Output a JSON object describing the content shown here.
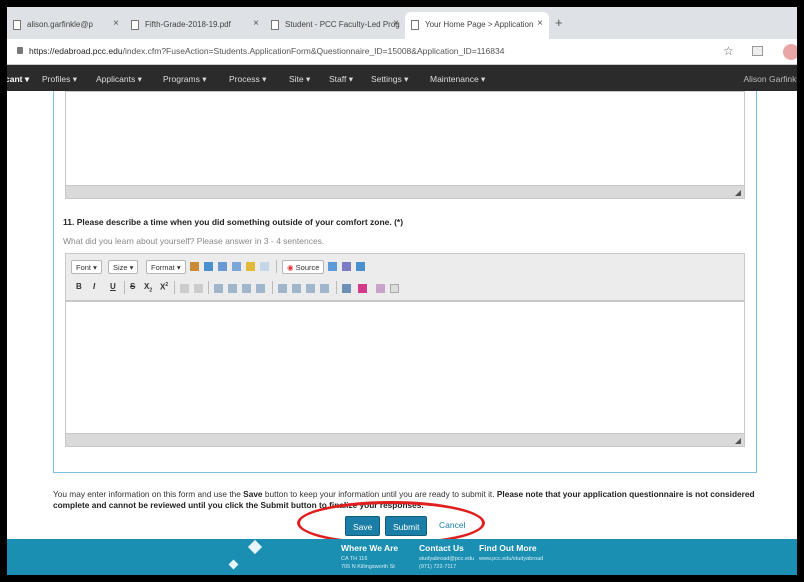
{
  "browser": {
    "tabs": [
      {
        "label": "alison.garfinkle@p",
        "active": false
      },
      {
        "label": "Fifth-Grade-2018-19.pdf",
        "active": false
      },
      {
        "label": "Student - PCC Faculty-Led Prog",
        "active": false
      },
      {
        "label": "Your Home Page > Application",
        "active": true
      }
    ],
    "new_tab": "+",
    "url_domain": "https://edabroad.pcc.edu",
    "url_path": "/index.cfm?FuseAction=Students.ApplicationForm&Questionnaire_ID=15008&Application_ID=116834",
    "star": "☆"
  },
  "nav": {
    "first": "cant",
    "items": [
      "Profiles",
      "Applicants",
      "Programs",
      "Process",
      "Site",
      "Staff",
      "Settings",
      "Maintenance"
    ],
    "user": "Alison Garfinkle"
  },
  "question": {
    "title": "11. Please describe a time when you did something outside of your comfort zone.  (*)",
    "hint": "What did you learn about yourself? Please answer in 3 - 4 sentences."
  },
  "editor": {
    "font": "Font",
    "size": "Size",
    "format": "Format",
    "source": "Source",
    "bold": "B",
    "italic": "I",
    "underline": "U"
  },
  "notice": {
    "p1": "You may enter information on this form and use the ",
    "save_word": "Save",
    "p2": " button to keep your information until you are ready to submit it. ",
    "bold1": "Please note that your application questionnaire is not considered complete and cannot be reviewed until you click the Submit button to finalize your responses."
  },
  "actions": {
    "save": "Save",
    "submit": "Submit",
    "cancel": "Cancel"
  },
  "footer": {
    "col1_title": "Where We Are",
    "col1_line1": "CA TH 116",
    "col1_line2": "705 N Killingsworth St",
    "col2_title": "Contact Us",
    "col2_line1": "studyabroad@pcc.edu",
    "col2_line2": "(971) 722-7117",
    "col3_title": "Find Out More",
    "col3_line1": "www.pcc.edu/studyabroad"
  },
  "colors": {
    "accent": "#1a7ea6",
    "footer": "#1a8fb1",
    "annotation_circle": "#e01e1e"
  }
}
